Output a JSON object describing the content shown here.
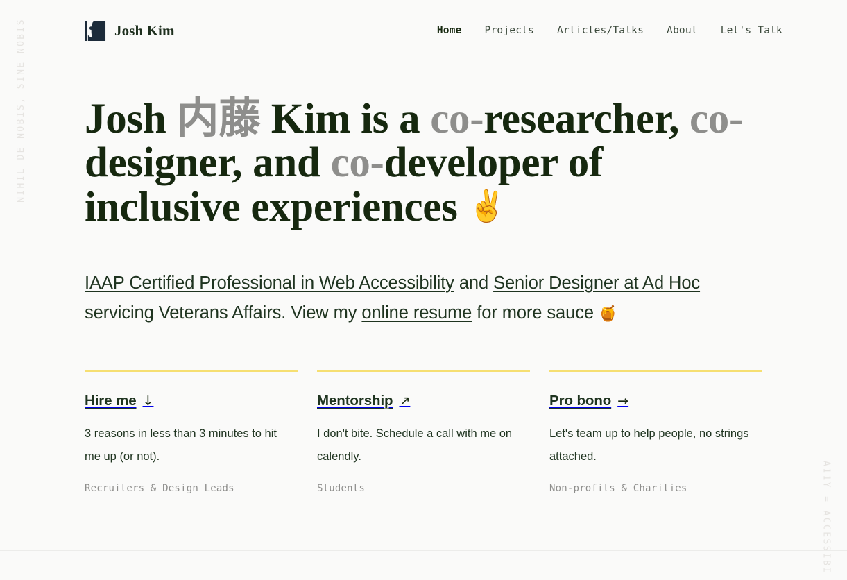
{
  "colors": {
    "background": "#fafaf9",
    "ink": "#16280f",
    "muted": "#8e8e8c",
    "accent_yellow": "#f6df72",
    "logo_navy": "#1c2b3a",
    "rule": "#ececea"
  },
  "rails": {
    "left_text": "NIHIL DE NOBIS, SINE NOBIS",
    "right_text": "A11Y = ACCESSIBI"
  },
  "header": {
    "brand_name": "Josh Kim",
    "logo_icon": "josh-kim-logo-icon",
    "nav": [
      {
        "label": "Home",
        "active": true
      },
      {
        "label": "Projects",
        "active": false
      },
      {
        "label": "Articles/Talks",
        "active": false
      },
      {
        "label": "About",
        "active": false
      },
      {
        "label": "Let's Talk",
        "active": false
      }
    ]
  },
  "hero": {
    "title_parts": [
      {
        "text": "Josh ",
        "muted": false
      },
      {
        "text": "内藤",
        "muted": true
      },
      {
        "text": " Kim is a ",
        "muted": false
      },
      {
        "text": "co-",
        "muted": true
      },
      {
        "text": "researcher, ",
        "muted": false
      },
      {
        "text": "co-",
        "muted": true
      },
      {
        "text": "designer, and ",
        "muted": false
      },
      {
        "text": "co-",
        "muted": true
      },
      {
        "text": "developer of inclusive experiences ",
        "muted": false
      }
    ],
    "title_emoji": "✌️",
    "sub": {
      "link1": "IAAP Certified Professional in Web Accessibility",
      "text1": " and ",
      "link2": "Senior Designer at Ad Hoc",
      "text2": " servicing Veterans Affairs. View my ",
      "link3": "online resume",
      "text3": " for more sauce ",
      "emoji": "🍯"
    }
  },
  "cards": [
    {
      "title": "Hire me ",
      "arrow": "↓",
      "arrow_icon": "arrow-down-icon",
      "description": "3 reasons in less than 3 minutes to hit me up (or not).",
      "audience": "Recruiters & Design Leads"
    },
    {
      "title": "Mentorship ",
      "arrow": "↗",
      "arrow_icon": "arrow-up-right-icon",
      "description": "I don't bite. Schedule a call with me on calendly.",
      "audience": "Students"
    },
    {
      "title": "Pro bono ",
      "arrow": "→",
      "arrow_icon": "arrow-right-icon",
      "description": "Let's team up to help people, no strings attached.",
      "audience": "Non-profits & Charities"
    }
  ]
}
